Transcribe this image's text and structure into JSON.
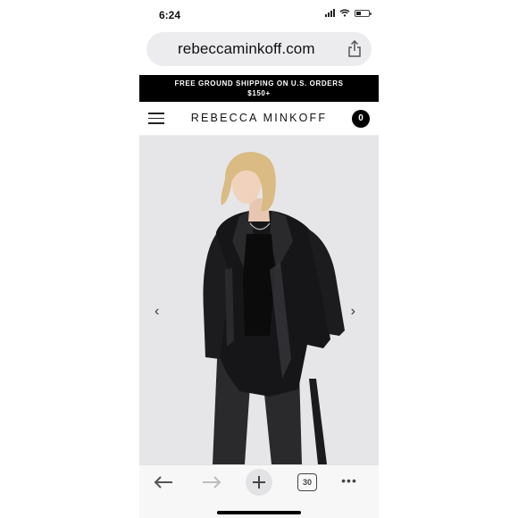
{
  "status_bar": {
    "time": "6:24"
  },
  "browser": {
    "url": "rebeccaminkoff.com",
    "share_icon": "share-icon"
  },
  "site": {
    "banner_line1": "FREE GROUND SHIPPING ON U.S. ORDERS",
    "banner_line2": "$150+",
    "brand": "REBECCA MINKOFF",
    "cart_count": "0",
    "menu_icon": "hamburger-menu-icon"
  },
  "carousel": {
    "prev_arrow": "‹",
    "next_arrow": "›"
  },
  "toolbar": {
    "tab_count": "30",
    "more": "•••"
  },
  "colors": {
    "banner_bg": "#000000",
    "hero_bg": "#e6e6e8",
    "url_bar_bg": "#ececef",
    "toolbar_bg": "#f7f7f8"
  }
}
